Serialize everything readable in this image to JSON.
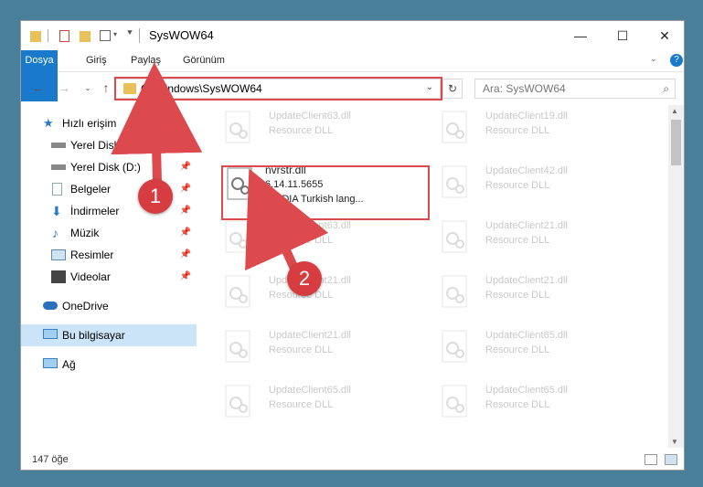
{
  "window": {
    "title": "SysWOW64"
  },
  "ribbon": {
    "tabs": [
      "Dosya",
      "Giriş",
      "Paylaş",
      "Görünüm"
    ]
  },
  "address": {
    "path": "C:\\Windows\\SysWOW64"
  },
  "search": {
    "placeholder": "Ara: SysWOW64"
  },
  "sidebar": {
    "items": [
      {
        "label": "Hızlı erişim"
      },
      {
        "label": "Yerel Disk (C:)"
      },
      {
        "label": "Yerel Disk (D:)"
      },
      {
        "label": "Belgeler"
      },
      {
        "label": "İndirmeler"
      },
      {
        "label": "Müzik"
      },
      {
        "label": "Resimler"
      },
      {
        "label": "Videolar"
      },
      {
        "label": "OneDrive"
      },
      {
        "label": "Bu bilgisayar"
      },
      {
        "label": "Ağ"
      }
    ]
  },
  "files": {
    "selected": {
      "name": "nvrstr.dll",
      "version": "6.14.11.5655",
      "description": "NVIDIA Turkish lang..."
    },
    "left": [
      {
        "name": "UpdateClient63.dll",
        "type": "Resource DLL"
      },
      {
        "name": "UpdateClient63.dll",
        "type": "Resource DLL"
      },
      {
        "name": "UpdateClient21.dll",
        "type": "Resource DLL"
      },
      {
        "name": "UpdateClient21.dll",
        "type": "Resource DLL"
      },
      {
        "name": "UpdateClient65.dll",
        "type": "Resource DLL"
      }
    ],
    "right": [
      {
        "name": "UpdateClient19.dll",
        "type": "Resource DLL"
      },
      {
        "name": "UpdateClient42.dll",
        "type": "Resource DLL"
      },
      {
        "name": "UpdateClient21.dll",
        "type": "Resource DLL"
      },
      {
        "name": "UpdateClient21.dll",
        "type": "Resource DLL"
      },
      {
        "name": "UpdateClient65.dll",
        "type": "Resource DLL"
      },
      {
        "name": "UpdateClient65.dll",
        "type": "Resource DLL"
      }
    ]
  },
  "status": {
    "count": "147 öğe"
  },
  "badges": {
    "one": "1",
    "two": "2"
  },
  "colors": {
    "accent": "#1979ca",
    "highlight": "#dc4a4e",
    "selected_bg": "#cce4f7"
  }
}
